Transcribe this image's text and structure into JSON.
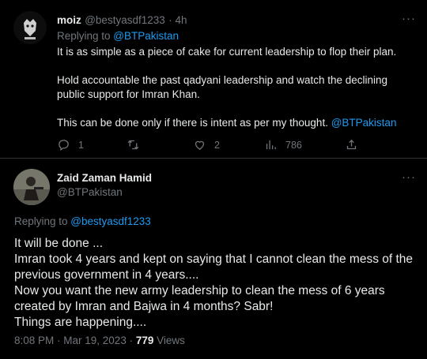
{
  "reply": {
    "name": "moiz",
    "handle": "@bestyasdf1233",
    "time": "· 4h",
    "replying_prefix": "Replying to ",
    "replying_to": "@BTPakistan",
    "paragraphs": [
      "It is as simple as a piece of cake for current leadership to flop their plan.",
      "Hold accountable the past qadyani leadership and watch the declining public support for Imran Khan.",
      "This can be done only if there is intent as per my thought."
    ],
    "mention": "@BTPakistan",
    "more": "···",
    "stats": {
      "replies": "1",
      "likes": "2",
      "views": "786"
    }
  },
  "main": {
    "name": "Zaid Zaman Hamid",
    "handle": "@BTPakistan",
    "more": "···",
    "replying_prefix": "Replying to ",
    "replying_to": "@bestyasdf1233",
    "lines": [
      "It will be done ...",
      "Imran took 4 years and kept on saying that I cannot clean the mess of the previous government in 4 years....",
      "Now you want the new army leadership to clean the mess of 6 years created by Imran and Bajwa in 4 months? Sabr!",
      "Things are happening...."
    ],
    "timestamp": "8:08 PM · Mar 19, 2023 · ",
    "views_count": "779",
    "views_label": " Views"
  },
  "icons": [
    "reply-icon",
    "retweet-icon",
    "like-icon",
    "views-icon",
    "share-icon",
    "more-icon"
  ]
}
